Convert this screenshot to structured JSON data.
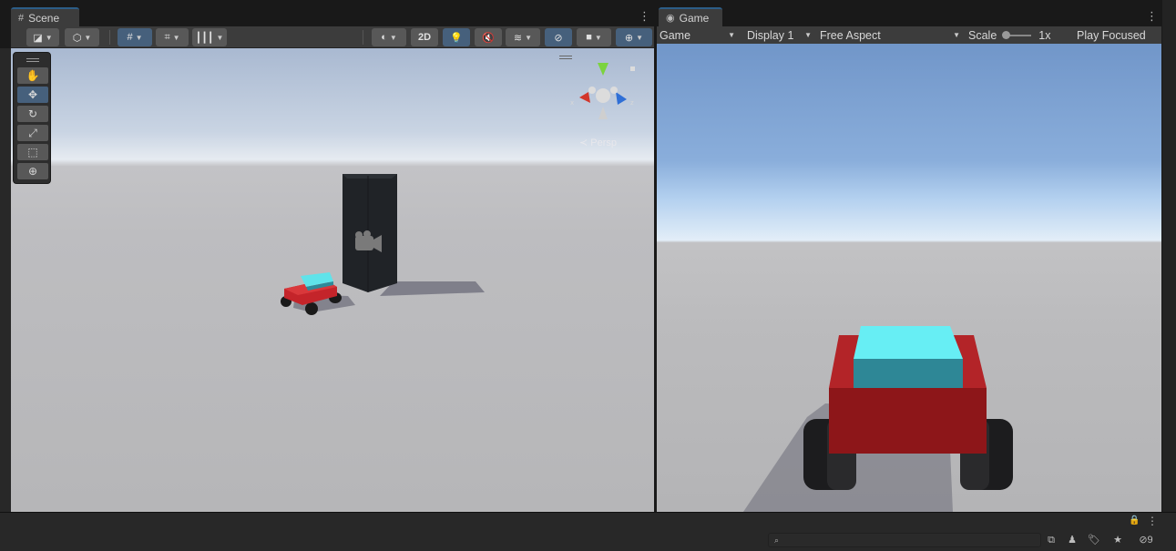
{
  "scene_tab": {
    "icon": "grid-icon",
    "label": "Scene"
  },
  "game_tab": {
    "icon": "gamepad-icon",
    "label": "Game"
  },
  "scene_toolbar": {
    "twod_label": "2D"
  },
  "scene_view": {
    "persp_label": "Persp",
    "gizmo_labels": {
      "x": "x",
      "y": "y",
      "z": "z"
    }
  },
  "game_toolbar": {
    "mode": "Game",
    "display": "Display 1",
    "aspect": "Free Aspect",
    "scale_label": "Scale",
    "scale_value": "1x",
    "play_focused": "Play Focused"
  },
  "bottom": {
    "hidden_count": "9"
  },
  "colors": {
    "accent": "#46607c",
    "car_body": "#c4242a",
    "car_cab": "#5fe3ea",
    "tower": "#202327"
  }
}
